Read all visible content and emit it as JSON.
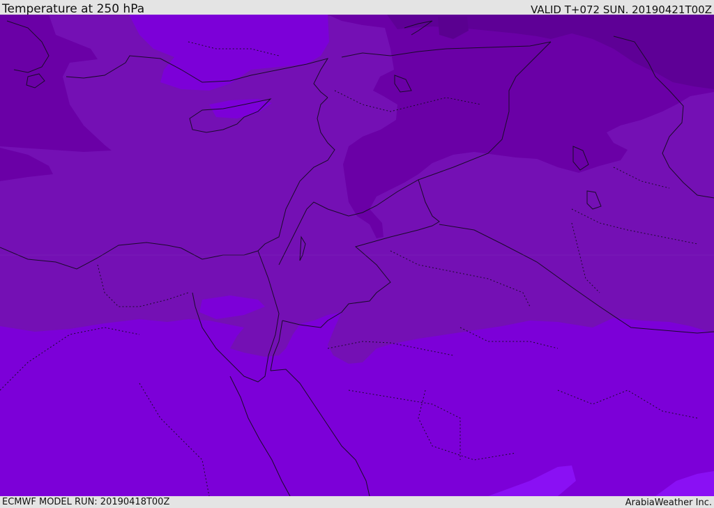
{
  "header": {
    "title": "Temperature at 250 hPa",
    "valid": "VALID T+072 SUN. 20190421T00Z"
  },
  "footer": {
    "model_run": "ECMWF MODEL RUN: 20190418T00Z",
    "credit": "ArabiaWeather Inc."
  },
  "colors": {
    "band_coldest": "#5e0096",
    "band_cold": "#6a00a6",
    "band_mid": "#7410b4",
    "band_warm": "#7c00d8",
    "band_warmest": "#8a10f4",
    "coastline": "#1a0a2a",
    "frame": "#e4e4e4"
  }
}
